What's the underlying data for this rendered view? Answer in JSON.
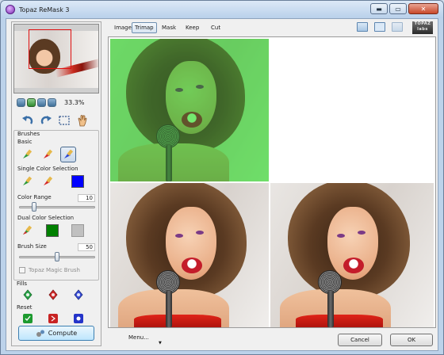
{
  "window": {
    "title": "Topaz ReMask 3",
    "controls": {
      "minimize": "▬",
      "maximize": "▭",
      "close": "✕"
    }
  },
  "navigator": {
    "zoom_value": "33.3%"
  },
  "tools": {
    "icons": [
      "undo-icon",
      "redo-icon",
      "marquee-select-icon",
      "hand-pan-icon"
    ]
  },
  "brushes": {
    "title": "Brushes",
    "basic_label": "Basic",
    "single_color_label": "Single Color Selection",
    "color_range_label": "Color Range",
    "color_range_value": "10",
    "color_range_fraction": 0.2,
    "dual_color_label": "Dual Color Selection",
    "brush_size_label": "Brush Size",
    "brush_size_value": "50",
    "brush_size_fraction": 0.5,
    "magic_brush_label": "Topaz Magic Brush",
    "single_swatch": "#0000ff",
    "dual_swatch_1": "#008000",
    "dual_swatch_2": "#c0c0c0"
  },
  "fills": {
    "title": "Fills",
    "colors": [
      "#2aa44a",
      "#d12a2a",
      "#3a4ed6"
    ]
  },
  "reset": {
    "title": "Reset",
    "colors": [
      "#1d9a2f",
      "#c82323",
      "#2434c9"
    ]
  },
  "compute": {
    "label": "Compute"
  },
  "view_tabs": [
    {
      "label": "Image"
    },
    {
      "label": "Trimap"
    },
    {
      "label": "Mask"
    },
    {
      "label": "Keep"
    },
    {
      "label": "Cut"
    }
  ],
  "active_tab": "Trimap",
  "brand": {
    "line1": "TOPAZ",
    "line2": "labs"
  },
  "bottom": {
    "menu_label": "Menu...",
    "menu_arrow": "▼",
    "cancel_label": "Cancel",
    "ok_label": "OK"
  }
}
